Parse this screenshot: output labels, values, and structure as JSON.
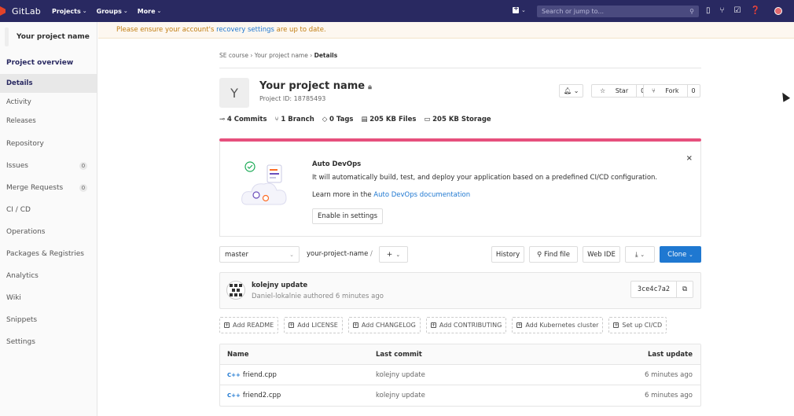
{
  "topbar": {
    "logo": "GitLab",
    "nav": [
      {
        "label": "Projects"
      },
      {
        "label": "Groups"
      },
      {
        "label": "More"
      }
    ],
    "search_placeholder": "Search or jump to..."
  },
  "sidebar": {
    "project_name": "Your project name",
    "overview": "Project overview",
    "sub": [
      "Details",
      "Activity",
      "Releases"
    ],
    "items": [
      {
        "label": "Repository",
        "count": ""
      },
      {
        "label": "Issues",
        "count": "0"
      },
      {
        "label": "Merge Requests",
        "count": "0"
      },
      {
        "label": "CI / CD",
        "count": ""
      },
      {
        "label": "Operations",
        "count": ""
      },
      {
        "label": "Packages & Registries",
        "count": ""
      },
      {
        "label": "Analytics",
        "count": ""
      },
      {
        "label": "Wiki",
        "count": ""
      },
      {
        "label": "Snippets",
        "count": ""
      },
      {
        "label": "Settings",
        "count": ""
      }
    ]
  },
  "alert": {
    "pre": "Please ensure your account's",
    "link": "recovery settings",
    "post": "are up to date."
  },
  "breadcrumb": {
    "a": "SE course",
    "b": "Your project name",
    "c": "Details"
  },
  "project": {
    "avatar_letter": "Y",
    "title": "Your project name",
    "id": "Project ID: 18785493",
    "star_label": "Star",
    "star_count": "0",
    "fork_label": "Fork",
    "fork_count": "0"
  },
  "stats": {
    "commits": "4 Commits",
    "branch": "1 Branch",
    "tags": "0 Tags",
    "files": "205 KB Files",
    "storage": "205 KB Storage"
  },
  "devops": {
    "title": "Auto DevOps",
    "desc": "It will automatically build, test, and deploy your application based on a predefined CI/CD configuration.",
    "learn_pre": "Learn more in the",
    "learn_link": "Auto DevOps documentation",
    "enable": "Enable in settings"
  },
  "repo": {
    "branch": "master",
    "path": "your-project-name",
    "history": "History",
    "find_file": "Find file",
    "web_ide": "Web IDE",
    "clone": "Clone"
  },
  "commit": {
    "title": "kolejny update",
    "author": "Daniel-lokalnie authored 6 minutes ago",
    "sha": "3ce4c7a2"
  },
  "add_buttons": [
    "Add README",
    "Add LICENSE",
    "Add CHANGELOG",
    "Add CONTRIBUTING",
    "Add Kubernetes cluster",
    "Set up CI/CD"
  ],
  "table": {
    "headers": [
      "Name",
      "Last commit",
      "Last update"
    ],
    "rows": [
      {
        "name": "friend.cpp",
        "commit": "kolejny update",
        "update": "6 minutes ago"
      },
      {
        "name": "friend2.cpp",
        "commit": "kolejny update",
        "update": "6 minutes ago"
      }
    ]
  }
}
